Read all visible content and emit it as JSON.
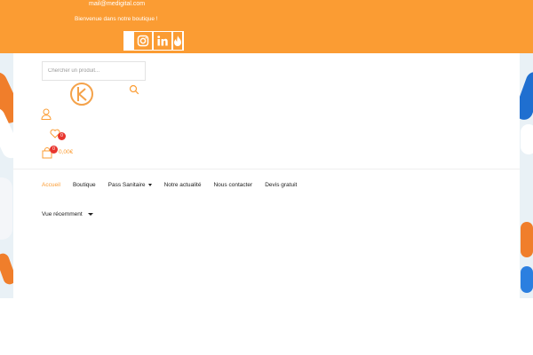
{
  "topbar": {
    "email": "mail@medigital.com",
    "welcome": "Bienvenue dans notre boutique !",
    "socials": [
      {
        "icon": "instagram-icon"
      },
      {
        "icon": "linkedin-icon"
      },
      {
        "icon": "fire-icon"
      }
    ]
  },
  "search": {
    "placeholder": "Chercher un produit..."
  },
  "header": {
    "wishlist_count": "0",
    "cart_count": "0",
    "cart_total": "0,00€"
  },
  "nav": {
    "items": [
      {
        "label": "Accueil"
      },
      {
        "label": "Boutique"
      },
      {
        "label": "Pass Sanitaire"
      },
      {
        "label": "Notre actualité"
      },
      {
        "label": "Nous contacter"
      },
      {
        "label": "Devis gratuit"
      }
    ]
  },
  "recent": {
    "label": "Vue récemment"
  },
  "colors": {
    "accent": "#fb9c33",
    "badge": "#e8352e"
  }
}
